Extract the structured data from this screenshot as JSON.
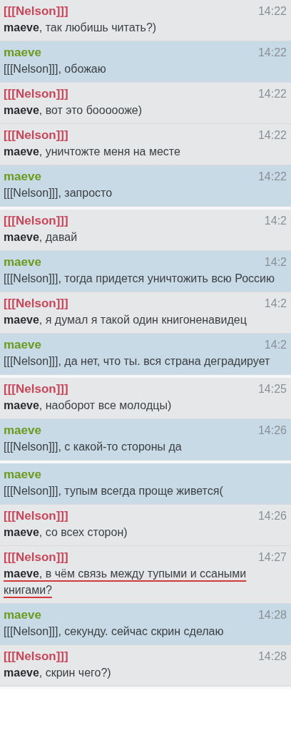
{
  "screens": [
    {
      "messages": [
        {
          "author": "[[[Nelson]]]",
          "color": "#c8465a",
          "highlighted": false,
          "time": "14:22",
          "text": "**maeve**, так любишь читать?)"
        },
        {
          "author": "maeve",
          "color": "#6a9a1e",
          "highlighted": true,
          "time": "14:22",
          "text": "[[[Nelson]]], обожаю"
        },
        {
          "author": "[[[Nelson]]]",
          "color": "#c8465a",
          "highlighted": false,
          "time": "14:22",
          "text": "**maeve**, вот это боооооже)"
        },
        {
          "author": "[[[Nelson]]]",
          "color": "#c8465a",
          "highlighted": false,
          "time": "14:22",
          "text": "**maeve**, уничтожте меня на месте"
        },
        {
          "author": "maeve",
          "color": "#6a9a1e",
          "highlighted": true,
          "time": "14:22",
          "text": "[[[Nelson]]], запросто"
        }
      ]
    },
    {
      "messages": [
        {
          "author": "[[[Nelson]]]",
          "color": "#c8465a",
          "highlighted": false,
          "time": "14:2",
          "text": "**maeve**, давай"
        },
        {
          "author": "maeve",
          "color": "#6a9a1e",
          "highlighted": true,
          "time": "14:2",
          "text": "[[[Nelson]]], тогда придется уничтожить всю Россию"
        },
        {
          "author": "[[[Nelson]]]",
          "color": "#c8465a",
          "highlighted": false,
          "time": "14:2",
          "text": "**maeve**, я думал я такой один книгоненавидец"
        },
        {
          "author": "maeve",
          "color": "#6a9a1e",
          "highlighted": true,
          "time": "14:2",
          "text": "[[[Nelson]]], да нет, что ты. вся страна деградирует"
        }
      ]
    },
    {
      "messages": [
        {
          "author": "[[[Nelson]]]",
          "color": "#c8465a",
          "highlighted": false,
          "time": "14:25",
          "text": "**maeve**, наоборот все молодцы)"
        },
        {
          "author": "maeve",
          "color": "#6a9a1e",
          "highlighted": true,
          "time": "14:26",
          "text": "[[[Nelson]]], с какой-то стороны да"
        }
      ]
    },
    {
      "messages": [
        {
          "author": "maeve",
          "color": "#6a9a1e",
          "highlighted": true,
          "text": "[[[Nelson]]], тупым всегда проще живется("
        },
        {
          "author": "[[[Nelson]]]",
          "color": "#c8465a",
          "highlighted": false,
          "time": "14:26",
          "text": "**maeve**, со всех сторон)"
        },
        {
          "author": "[[[Nelson]]]",
          "color": "#c8465a",
          "highlighted": false,
          "time": "14:27",
          "underlined": true,
          "text": "**maeve**, в чём связь между тупыми и ссаными книгами?"
        },
        {
          "author": "maeve",
          "color": "#6a9a1e",
          "highlighted": true,
          "time": "14:28",
          "text": "[[[Nelson]]], секунду. сейчас скрин сделаю"
        },
        {
          "author": "[[[Nelson]]]",
          "color": "#c8465a",
          "highlighted": false,
          "time": "14:28",
          "text": "**maeve**, скрин чего?)"
        }
      ]
    }
  ]
}
